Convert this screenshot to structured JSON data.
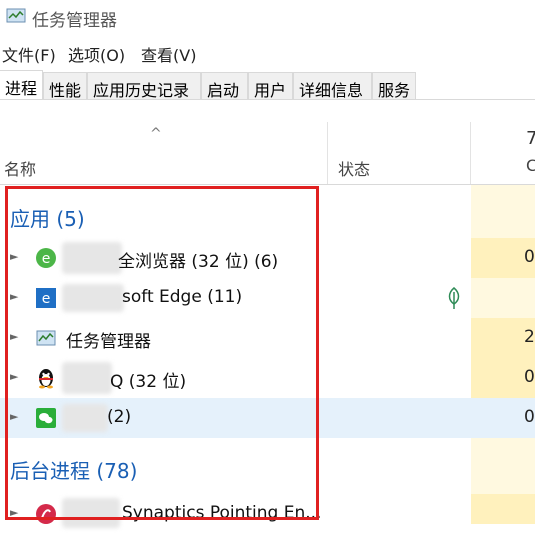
{
  "window": {
    "title": "任务管理器",
    "icon": "task-manager-icon"
  },
  "menu": {
    "items": [
      "文件(F)",
      "选项(O)",
      "查看(V)"
    ]
  },
  "tabs": [
    "进程",
    "性能",
    "应用历史记录",
    "启动",
    "用户",
    "详细信息",
    "服务"
  ],
  "active_tab": 0,
  "columns": {
    "name": "名称",
    "status": "状态",
    "cpu_top": "7",
    "cpu_sub": "C"
  },
  "groups": {
    "apps": "应用 (5)",
    "background": "后台进程 (78)"
  },
  "rows": [
    {
      "name": "全浏览器 (32 位) (6)",
      "cpu": "0",
      "icon": "360-browser-icon",
      "status_icon": ""
    },
    {
      "name": "soft Edge (11)",
      "cpu": "",
      "icon": "edge-icon",
      "status_icon": "leaf-icon"
    },
    {
      "name": "任务管理器",
      "cpu": "2",
      "icon": "task-manager-icon",
      "status_icon": ""
    },
    {
      "name": "Q (32 位)",
      "cpu": "0",
      "icon": "qq-penguin-icon",
      "status_icon": ""
    },
    {
      "name": "(2)",
      "cpu": "0",
      "icon": "wechat-icon",
      "status_icon": ""
    },
    {
      "name": "Synaptics Pointing En...",
      "cpu": "",
      "icon": "synaptics-icon",
      "status_icon": ""
    }
  ],
  "colors": {
    "accent": "#1a5fb4",
    "highlight": "#e02020",
    "cpu_yellow": "#fff4c4",
    "selected": "#e5f1fb"
  }
}
